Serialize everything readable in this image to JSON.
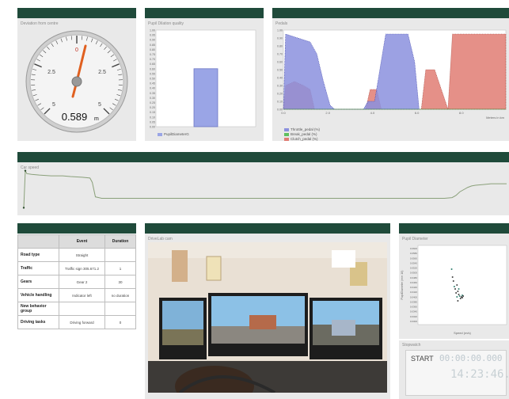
{
  "gauge": {
    "title": "Deviation from centre",
    "value": "0.589",
    "unit": "m",
    "ticks": [
      "0",
      "2.5",
      "2.5",
      "5",
      "5"
    ]
  },
  "pupil_quality": {
    "title": "Pupil Dilation quality",
    "legend": "PupilDiameterG",
    "colors": {
      "bar": "#9aa5e6"
    }
  },
  "pedals": {
    "title": "Pedals",
    "legend": [
      "Throttle_pedal (%)",
      "Break_pedal (%)",
      "Clutch_pedal (%)"
    ],
    "xlabel": "Meters in km",
    "colors": {
      "throttle": "#8b90de",
      "brake": "#5fbf5f",
      "clutch": "#e07c73"
    }
  },
  "car_speed": {
    "title": "Car speed"
  },
  "events": {
    "headers": [
      "",
      "Event",
      "Duration"
    ],
    "rows": [
      {
        "label": "Road type",
        "event": "Straight",
        "duration": ""
      },
      {
        "label": "Traffic",
        "event": "Traffic sign 305.671.2",
        "duration": "1"
      },
      {
        "label": "Gears",
        "event": "Gear 2",
        "duration": "30"
      },
      {
        "label": "Vehicle handling",
        "event": "Indicator left",
        "duration": "no duration"
      },
      {
        "label": "New behavior group",
        "event": "",
        "duration": ""
      },
      {
        "label": "Driving tasks",
        "event": "Driving forward",
        "duration": "0"
      }
    ]
  },
  "cam": {
    "title": "DriveLab cam"
  },
  "pupil_diameter": {
    "title": "Pupil Diameter",
    "xlabel": "Speed (m/s)",
    "ylabel": "PupilDiameter (mm 10)"
  },
  "stopwatch": {
    "title": "Stopwatch",
    "start_label": "START",
    "top_digits": "00:00:00.000",
    "bottom_digits": "14:23:46."
  },
  "chart_data": [
    {
      "type": "bar",
      "title": "Pupil Dilation quality",
      "categories": [
        "PupilDiameterG"
      ],
      "series": [
        {
          "name": "PupilDiameterG",
          "values": [
            0.6
          ]
        }
      ],
      "ylim": [
        0,
        1
      ],
      "yticks": [
        "0.00",
        "0.05",
        "0.10",
        "0.15",
        "0.20",
        "0.25",
        "0.30",
        "0.35",
        "0.40",
        "0.45",
        "0.50",
        "0.55",
        "0.60",
        "0.65",
        "0.70",
        "0.75",
        "0.80",
        "0.85",
        "0.90",
        "0.95",
        "1.00"
      ]
    },
    {
      "type": "area",
      "title": "Pedals",
      "xlabel": "Meters in km",
      "xticks": [
        "0.0",
        "2.0",
        "4.0",
        "6.0",
        "8.0"
      ],
      "yticks": [
        "0.00",
        "0.10",
        "0.20",
        "0.30",
        "0.40",
        "0.50",
        "0.60",
        "0.70",
        "0.80",
        "0.90",
        "1.00"
      ],
      "ylim": [
        0,
        1
      ],
      "xlim": [
        0,
        10
      ],
      "series": [
        {
          "name": "Throttle_pedal (%)",
          "x": [
            0.0,
            0.1,
            1.2,
            1.5,
            1.8,
            2.1,
            2.3,
            3.6,
            3.8,
            4.1,
            4.6,
            5.3,
            5.6,
            5.9,
            6.1
          ],
          "values": [
            0.0,
            0.95,
            0.85,
            0.7,
            0.35,
            0.05,
            0.0,
            0.0,
            0.1,
            0.1,
            0.95,
            0.95,
            0.95,
            0.6,
            0.0
          ]
        },
        {
          "name": "Break_pedal (%)",
          "x": [
            0,
            10
          ],
          "values": [
            0,
            0
          ]
        },
        {
          "name": "Clutch_pedal (%)",
          "x": [
            0.0,
            0.1,
            0.5,
            0.9,
            1.2,
            1.4,
            3.7,
            3.9,
            4.2,
            4.4,
            6.2,
            6.4,
            6.8,
            7.4,
            7.6,
            10.0
          ],
          "values": [
            0.0,
            0.3,
            0.35,
            0.3,
            0.25,
            0.0,
            0.0,
            0.25,
            0.25,
            0.0,
            0.0,
            0.5,
            0.5,
            0.0,
            0.95,
            0.95
          ]
        }
      ]
    },
    {
      "type": "line",
      "title": "Car speed",
      "x": [
        0,
        2,
        4,
        10,
        20,
        35,
        50,
        60,
        75,
        85,
        88,
        92,
        100,
        110,
        120,
        130,
        140,
        150,
        160,
        170,
        180,
        190,
        200,
        210,
        220,
        230,
        240,
        250,
        260,
        270,
        280,
        290,
        300,
        310,
        320,
        330,
        340,
        350,
        360,
        370,
        380,
        390,
        400,
        410,
        420,
        430,
        440,
        450,
        460,
        470,
        480,
        490,
        500,
        510,
        520,
        530,
        540,
        550,
        555,
        560,
        565,
        570,
        575,
        580,
        590,
        600,
        610,
        620
      ],
      "values": [
        5,
        56,
        52,
        51,
        50,
        49,
        49,
        48,
        47,
        46,
        40,
        20,
        18,
        18,
        18,
        18,
        18,
        18,
        18,
        18,
        18,
        18,
        18,
        18,
        18,
        18,
        18,
        18,
        18,
        18,
        18,
        18,
        18,
        18,
        18,
        18,
        18,
        18,
        18,
        18,
        18,
        18,
        18,
        18,
        18,
        18,
        18,
        18,
        18,
        18,
        18,
        18,
        18,
        18,
        18,
        18,
        18,
        19,
        22,
        27,
        30,
        33,
        35,
        36,
        37,
        38,
        38,
        38
      ],
      "ylim": [
        0,
        60
      ]
    },
    {
      "type": "scatter",
      "title": "Pupil Diameter",
      "xlabel": "Speed (m/s)",
      "ylabel": "PupilDiameter (mm 10)",
      "xlim": [
        0,
        1
      ],
      "ylim": [
        0,
        1
      ],
      "x": [
        0.38,
        0.39,
        0.4,
        0.41,
        0.42,
        0.43,
        0.44,
        0.45,
        0.46,
        0.47,
        0.48,
        0.49,
        0.5,
        0.44,
        0.45,
        0.46,
        0.5,
        0.51
      ],
      "values": [
        0.7,
        0.6,
        0.55,
        0.48,
        0.45,
        0.4,
        0.35,
        0.42,
        0.38,
        0.36,
        0.33,
        0.35,
        0.37,
        0.5,
        0.3,
        0.45,
        0.34,
        0.36
      ],
      "yticks": [
        "0.0600",
        "0.0580",
        "0.0560",
        "0.0540",
        "0.0520",
        "0.0500",
        "0.0480",
        "0.0460",
        "0.0440",
        "0.0420",
        "0.0400",
        "0.0380",
        "0.0360",
        "0.0340",
        "0.0320",
        "0.0300"
      ]
    }
  ]
}
